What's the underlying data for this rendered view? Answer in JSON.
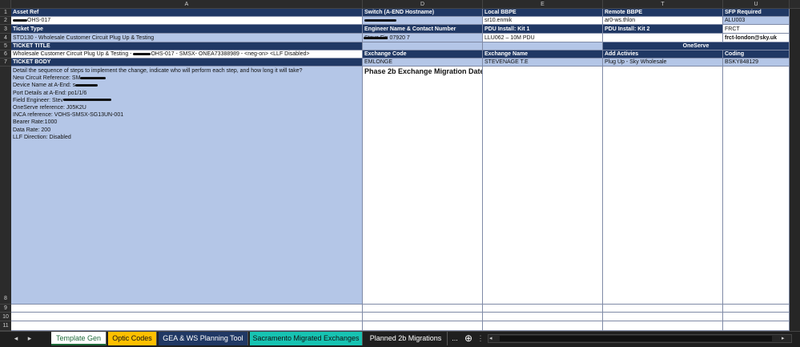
{
  "columns": [
    "A",
    "D",
    "E",
    "T",
    "U"
  ],
  "rows": [
    "1",
    "2",
    "3",
    "4",
    "5",
    "6",
    "7",
    "8",
    "9",
    "10",
    "11"
  ],
  "r1": {
    "a": "Asset Ref",
    "d": "Switch (A-END Hostname)",
    "e": "Local BBPE",
    "t": "Remote BBPE",
    "u": "SFP Required"
  },
  "r2": {
    "a": "OHS-017",
    "e": "sr10.enmik",
    "t": "ar0-ws.thlon",
    "u": "ALU003"
  },
  "r3": {
    "a": "Ticket Type",
    "d": "Engineer Name & Contact Number",
    "e": "PDU Install: Kit 1",
    "t": "PDU Install: Kit 2",
    "u": "FRCT"
  },
  "r4": {
    "a": "STD130 - Wholesale Customer Circuit Plug Up & Testing",
    "d": "Steve Fin 07920 7",
    "e": "LLU062 – 10M PDU",
    "t": "",
    "u": "frct-london@sky.uk"
  },
  "r5": {
    "a": "TICKET TITLE",
    "tu": "OneServe"
  },
  "r6": {
    "a_pre": "Wholesale Customer Circuit Plug Up & Testing - ",
    "a_post": "OHS-017 - SMSX- ONEA73388989 - <neg-on> <LLF Disabled>",
    "d": "Exchange Code",
    "e": "Exchange Name",
    "t": "Add Activies",
    "u": "Coding"
  },
  "r7": {
    "a": "TICKET BODY",
    "d": "EMLONGE",
    "e": "STEVENAGE T.E",
    "t": "Plug Up - Sky Wholesale",
    "u": "BSKY848129"
  },
  "body": {
    "intro": "Detail the sequence of steps to implement the change, indicate who will perform each step, and how long it will take?",
    "new_circuit": "New Circuit Reference: SM",
    "device": "Device Name at A-End: s",
    "port": "Port Details at A-End: po1/1/6",
    "engineer": "Field Engineer: Stev",
    "oneserve": "OneServe reference: J05K2U",
    "inca": "INCA reference: VOHS-SMSX-SG13UN-001",
    "bearer": "Bearer Rate:1000",
    "data_rate": "Data Rate: 200",
    "llf": "LLF Direction: Disabled"
  },
  "migration_label": "Phase 2b Exchange Migration Date:",
  "tabs": [
    {
      "label": "Template Gen",
      "bg": "#ffffff",
      "fg": "#1f6b3a"
    },
    {
      "label": "Optic Codes",
      "bg": "#ffc000",
      "fg": "#111111"
    },
    {
      "label": "GEA & WS Planning Tool",
      "bg": "#203864",
      "fg": "#ffffff"
    },
    {
      "label": "Sacramento Migrated Exchanges",
      "bg": "#17c3b2",
      "fg": "#111111"
    },
    {
      "label": "Planned 2b Migrations",
      "bg": "#1f1f1f",
      "fg": "#ffffff"
    }
  ],
  "tab_more": "...",
  "colors": {
    "header": "#203864",
    "light": "#b4c6e7",
    "active_tab": "#1f6b3a"
  }
}
